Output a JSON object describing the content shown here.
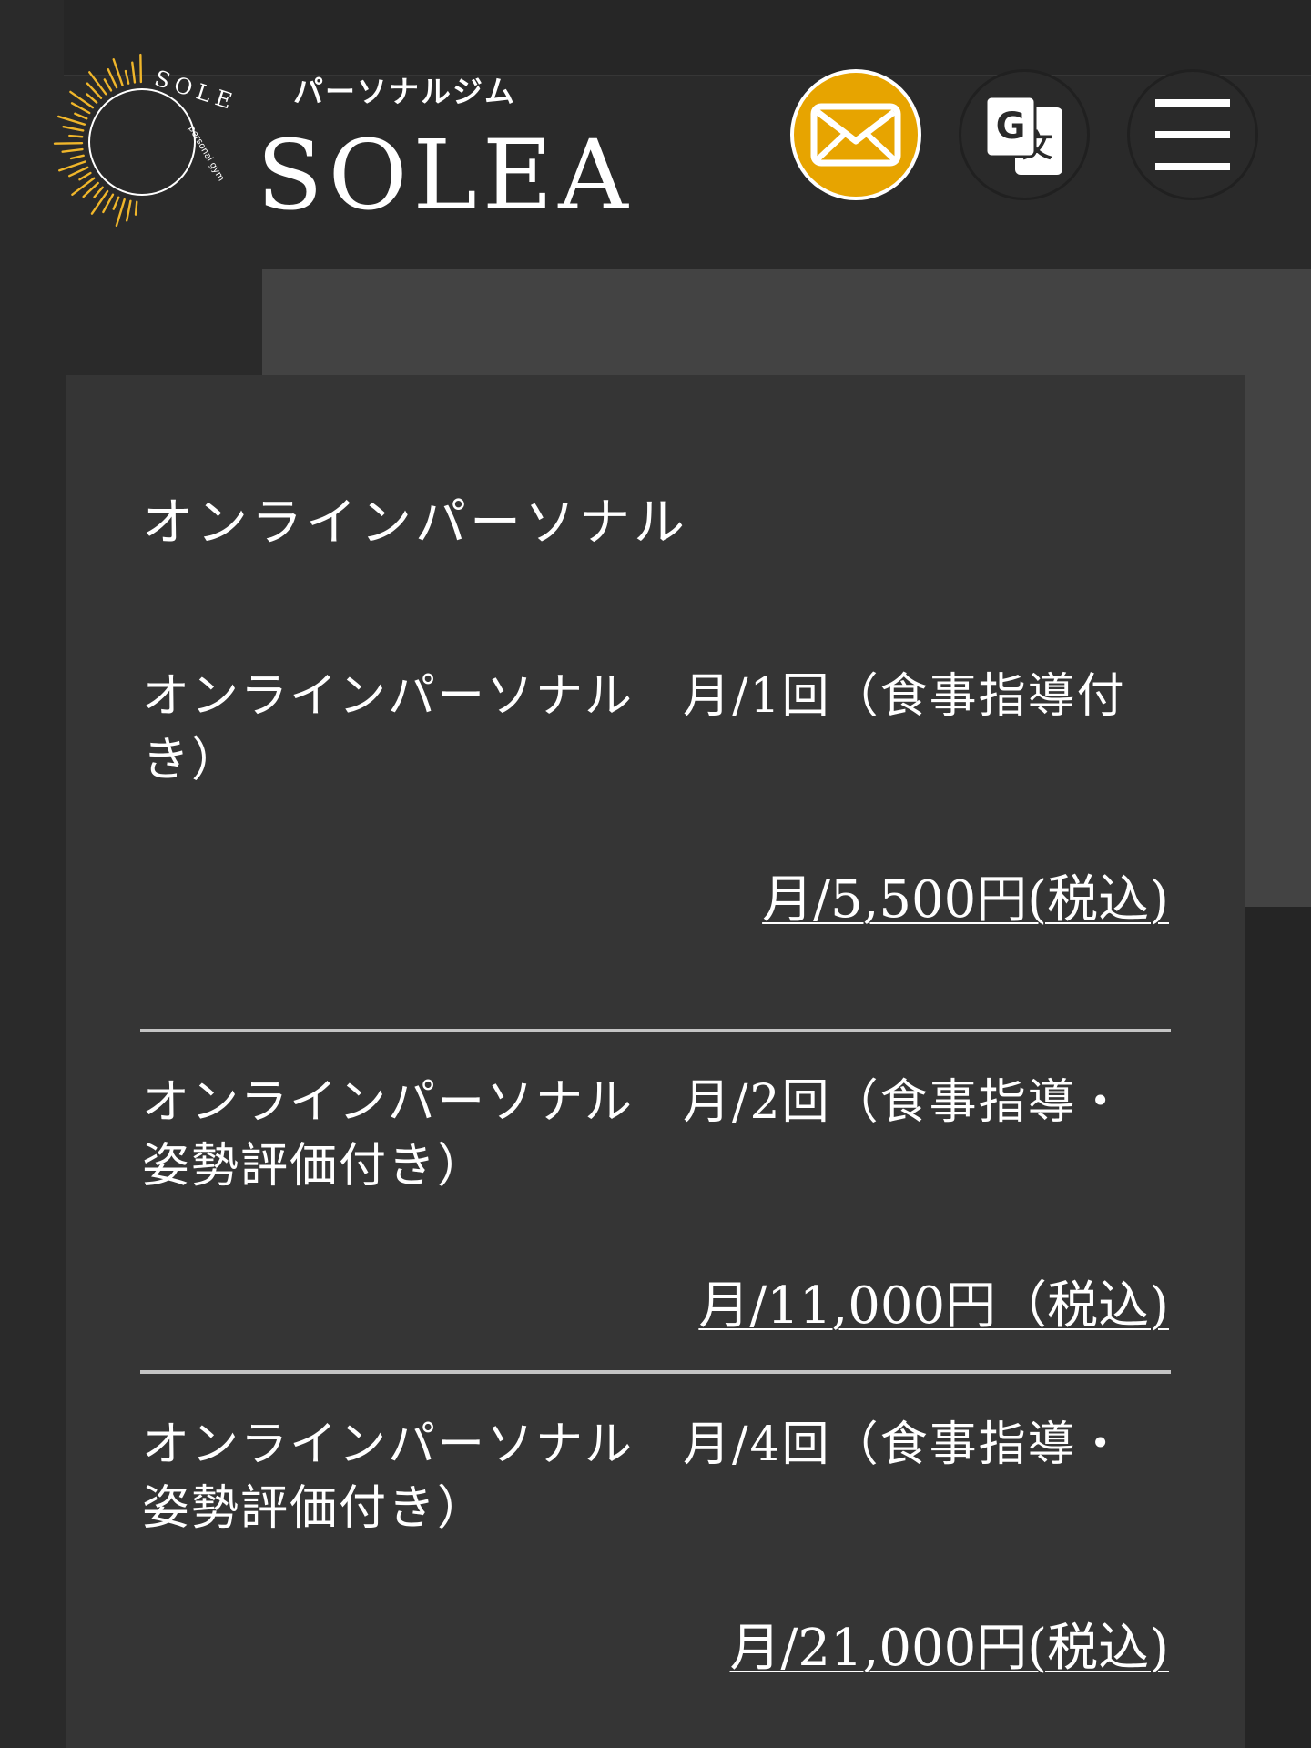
{
  "header": {
    "brand_sub": "パーソナルジム",
    "brand_main": "SOLEA",
    "logo_text_top": "SOLEA",
    "logo_text_small": "personal gym",
    "mail_icon": "envelope-icon",
    "translate_icon": "google-translate-icon",
    "menu_icon": "hamburger-menu-icon",
    "colors": {
      "mail_button": "#e7a400",
      "logo_rays": "#f0b62a"
    }
  },
  "section": {
    "title": "オンラインパーソナル",
    "plans": [
      {
        "name": "オンラインパーソナル　月/1回（食事指導付き）",
        "price": "月/5,500円(税込)"
      },
      {
        "name": "オンラインパーソナル　月/2回（食事指導・姿勢評価付き）",
        "price": "月/11,000円（税込)"
      },
      {
        "name": "オンラインパーソナル　月/4回（食事指導・姿勢評価付き）",
        "price": "月/21,000円(税込)"
      }
    ]
  }
}
